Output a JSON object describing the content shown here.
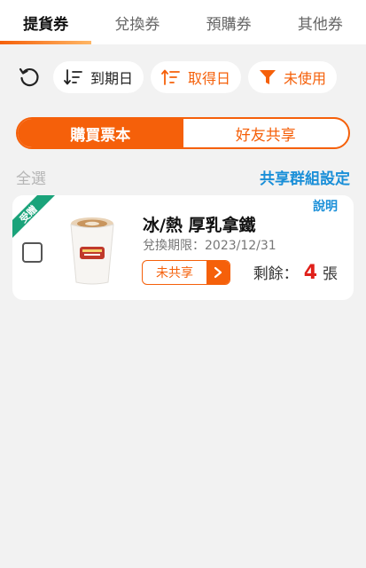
{
  "tabs": [
    {
      "label": "提貨券",
      "active": true
    },
    {
      "label": "兌換券",
      "active": false
    },
    {
      "label": "預購券",
      "active": false
    },
    {
      "label": "其他券",
      "active": false
    }
  ],
  "filters": {
    "refresh_icon": "refresh-icon",
    "sort_expiry": {
      "label": "到期日",
      "icon": "sort-descending-icon"
    },
    "sort_obtained": {
      "label": "取得日",
      "icon": "sort-ascending-icon"
    },
    "status_filter": {
      "label": "未使用",
      "icon": "filter-funnel-icon"
    }
  },
  "segment": {
    "options": [
      "購買票本",
      "好友共享"
    ],
    "selected": "購買票本"
  },
  "select_all_label": "全選",
  "group_setting_label": "共享群組設定",
  "coupon": {
    "ribbon": "受贈",
    "help_label": "說明",
    "title": "冰/熱 厚乳拿鐵",
    "expiry": "兌換期限：2023/12/31",
    "share_status": "未共享",
    "remaining_label": "剩餘：",
    "remaining_count": "4",
    "remaining_unit": "張",
    "image_icon": "latte-cup-image"
  },
  "colors": {
    "accent": "#f5600a",
    "link": "#1a8fd8",
    "ribbon": "#1aa37a",
    "count": "#e0201a"
  }
}
